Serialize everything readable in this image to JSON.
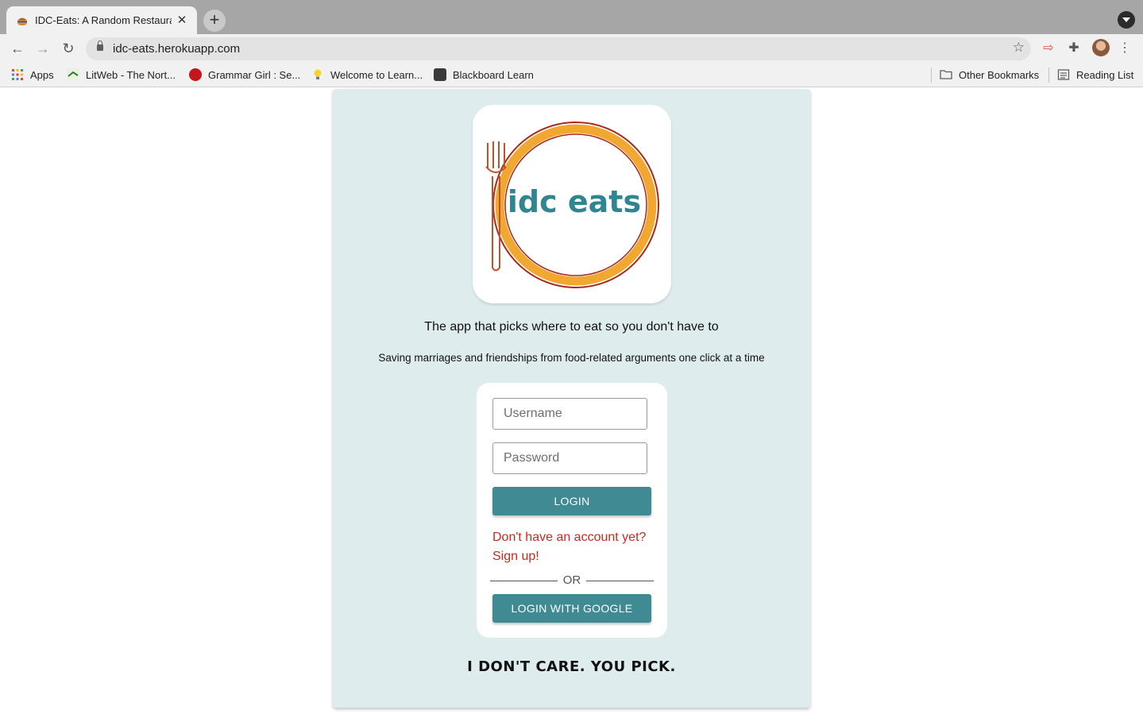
{
  "browser": {
    "tab_title": "IDC-Eats: A Random Restaurant",
    "url": "idc-eats.herokuapp.com",
    "bookmarks": [
      {
        "label": "Apps",
        "icon": "apps-grid-icon"
      },
      {
        "label": "LitWeb - The Nort...",
        "icon": "litweb-icon"
      },
      {
        "label": "Grammar Girl : Se...",
        "icon": "grammar-girl-icon"
      },
      {
        "label": "Welcome to Learn...",
        "icon": "lightbulb-icon"
      },
      {
        "label": "Blackboard Learn",
        "icon": "blackboard-icon"
      }
    ],
    "other_bookmarks": "Other Bookmarks",
    "reading_list": "Reading List"
  },
  "page": {
    "logo_text": "idc eats",
    "tagline": "The app that picks where to eat so you don't have to",
    "subtagline": "Saving marriages and friendships from food-related arguments one click at a time",
    "login": {
      "username_placeholder": "Username",
      "password_placeholder": "Password",
      "login_label": "LOGIN",
      "signup_text": "Don't have an account yet? Sign up!",
      "or_text": "OR",
      "google_label": "LOGIN WITH GOOGLE"
    },
    "slogan": "I DON'T CARE. YOU PICK."
  },
  "colors": {
    "card_bg": "#dfeced",
    "button_teal": "#3f8a93",
    "signup_red": "#c62b1c",
    "logo_text_teal": "#2f8590",
    "plate_orange": "#f0a830",
    "plate_red": "#a8281c"
  }
}
